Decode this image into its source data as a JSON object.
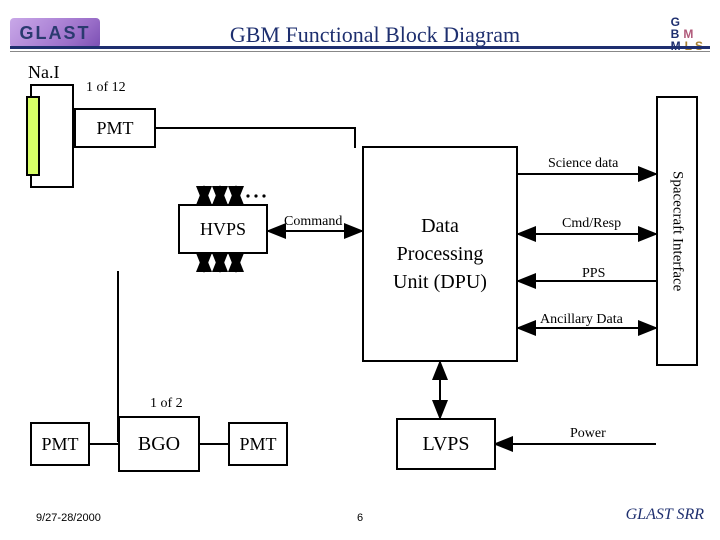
{
  "header": {
    "logo": "GLAST",
    "title": "GBM Functional Block Diagram",
    "gbmls_g": "G",
    "gbmls_b": "B",
    "gbmls_m1": "M",
    "gbmls_m": "M",
    "gbmls_ls": "LS"
  },
  "blocks": {
    "nai": "Na.I",
    "nai_count": "1 of 12",
    "pmt": "PMT",
    "hvps": "HVPS",
    "command": "Command",
    "dpu_l1": "Data",
    "dpu_l2": "Processing",
    "dpu_l3": "Unit (DPU)",
    "science": "Science data",
    "cmdresp": "Cmd/Resp",
    "pps": "PPS",
    "ancillary": "Ancillary Data",
    "spacecraft_if": "Spacecraft Interface",
    "bgo_count": "1 of 2",
    "bgo_pmt1": "PMT",
    "bgo": "BGO",
    "bgo_pmt2": "PMT",
    "lvps": "LVPS",
    "power": "Power"
  },
  "footer": {
    "date": "9/27-28/2000",
    "page": "6",
    "srr": "GLAST SRR"
  }
}
